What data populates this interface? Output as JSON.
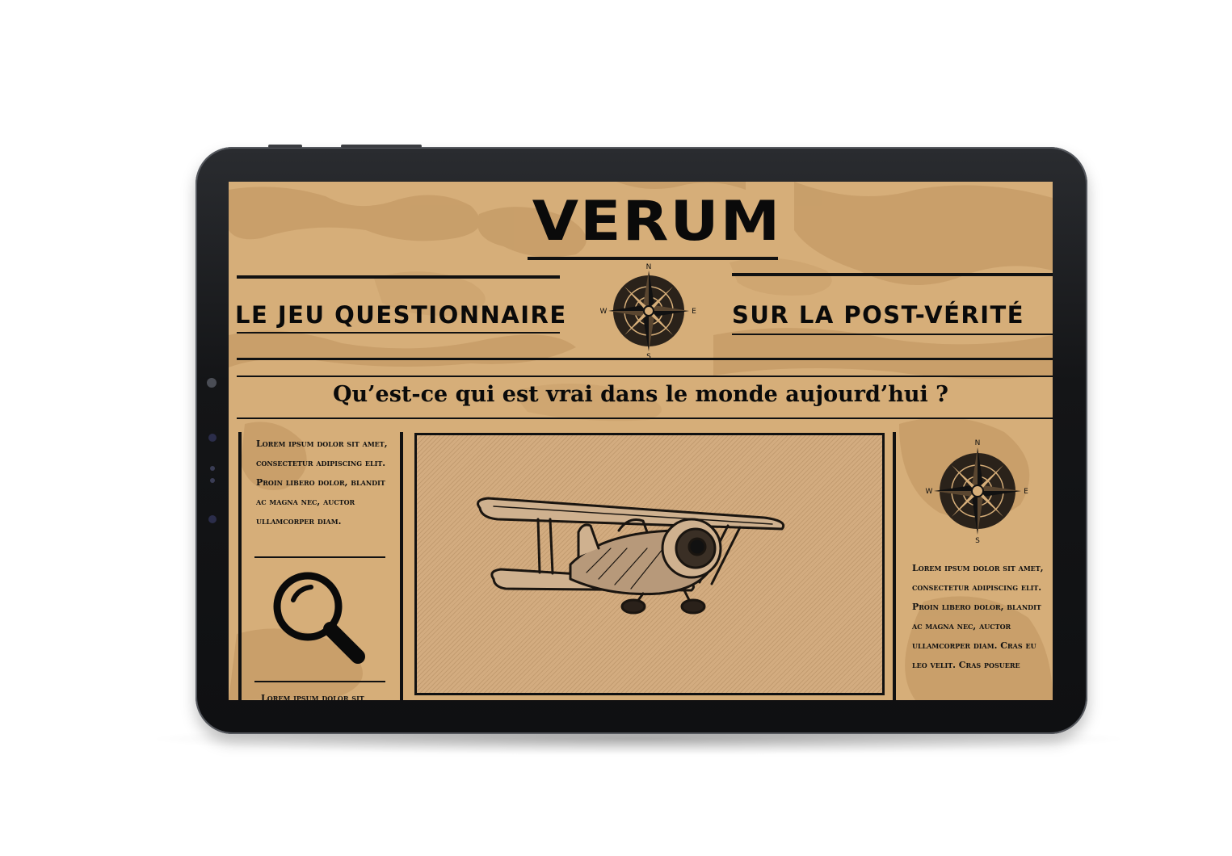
{
  "newspaper": {
    "masthead": "VERUM",
    "banner_left": "LE JEU QUESTIONNAIRE",
    "banner_right": "SUR LA POST-VÉRITÉ",
    "question": "Qu’est-ce qui est vrai dans le monde aujourd’hui ?",
    "left_column": {
      "paragraph_1": "Lorem ipsum dolor sit amet, consectetur adipiscing elit. Proin libero dolor, blandit ac magna nec, auctor ullamcorper diam.",
      "paragraph_2": "Lorem ipsum dolor sit"
    },
    "right_column": {
      "paragraph_1": "Lorem ipsum dolor sit amet, consectetur adipiscing elit. Proin libero dolor, blandit ac magna nec, auctor ullamcorper diam. Cras eu leo velit. Cras posuere"
    },
    "compass_labels": {
      "n": "N",
      "e": "E",
      "s": "S",
      "w": "W"
    }
  },
  "icons": [
    "compass-icon",
    "magnifier-icon",
    "biplane-illustration"
  ],
  "colors": {
    "paper": "#d6ae79",
    "paper_stain": "#c49a66",
    "ink": "#111111",
    "device_frame": "#141517"
  }
}
